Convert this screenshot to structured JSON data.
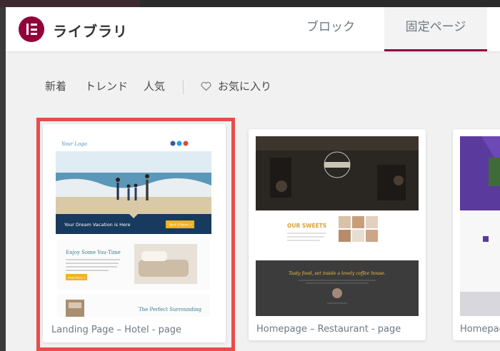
{
  "header": {
    "app_title": "ライブラリ",
    "tabs": [
      {
        "label": "ブロック",
        "active": false
      },
      {
        "label": "固定ページ",
        "active": true
      }
    ],
    "accent_color": "#92003b"
  },
  "filters": {
    "items": [
      "新着",
      "トレンド",
      "人気"
    ],
    "favorites_label": "お気に入り",
    "favorites_icon": "heart-icon"
  },
  "templates": [
    {
      "caption": "Landing Page – Hotel - page",
      "selected": true,
      "preview": {
        "logo_text": "Your Logo",
        "banner_text": "Your Dream Vacation is Here",
        "book_button": "Book A Room →",
        "section_title": "Enjoy Some You-Time",
        "read_more": "Read More →",
        "subsection_title": "The Perfect Surrounding"
      }
    },
    {
      "caption": "Homepage – Restaurant - page",
      "selected": false,
      "preview": {
        "sweets_title": "OUR SWEETS",
        "quote": "Tasty food, set inside a lovely coffee house."
      }
    },
    {
      "caption": "Homepag",
      "selected": false
    }
  ],
  "selection_color": "#e84c4c"
}
